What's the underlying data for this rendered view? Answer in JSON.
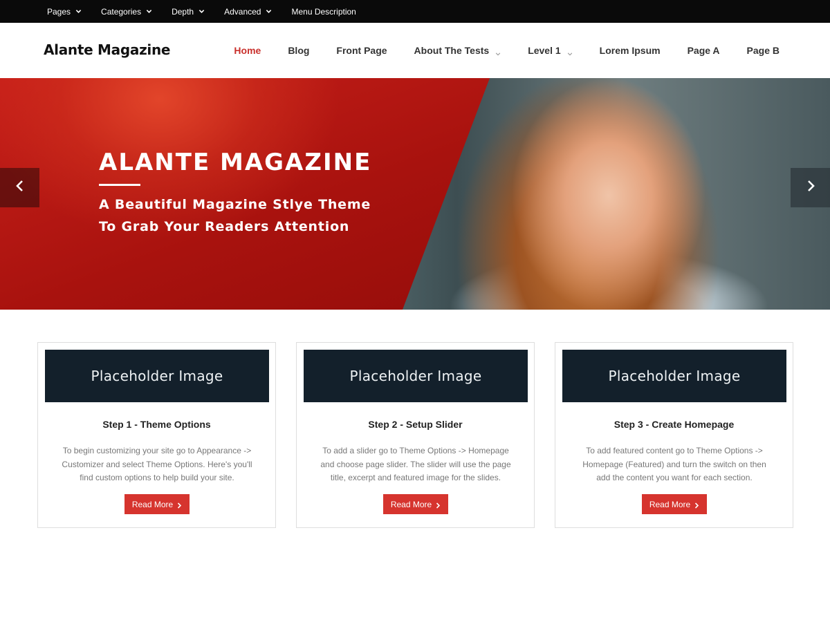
{
  "topbar": {
    "items": [
      {
        "label": "Pages",
        "has_dropdown": true
      },
      {
        "label": "Categories",
        "has_dropdown": true
      },
      {
        "label": "Depth",
        "has_dropdown": true
      },
      {
        "label": "Advanced",
        "has_dropdown": true
      },
      {
        "label": "Menu Description",
        "has_dropdown": false
      }
    ]
  },
  "header": {
    "site_title": "Alante Magazine",
    "nav": [
      {
        "label": "Home",
        "active": true,
        "has_dropdown": false
      },
      {
        "label": "Blog",
        "active": false,
        "has_dropdown": false
      },
      {
        "label": "Front Page",
        "active": false,
        "has_dropdown": false
      },
      {
        "label": "About The Tests",
        "active": false,
        "has_dropdown": true
      },
      {
        "label": "Level 1",
        "active": false,
        "has_dropdown": true
      },
      {
        "label": "Lorem Ipsum",
        "active": false,
        "has_dropdown": false
      },
      {
        "label": "Page A",
        "active": false,
        "has_dropdown": false
      },
      {
        "label": "Page B",
        "active": false,
        "has_dropdown": false
      }
    ]
  },
  "hero": {
    "title": "ALANTE MAGAZINE",
    "subtitle_line1": "A Beautiful Magazine Stlye Theme",
    "subtitle_line2": "To Grab Your Readers Attention",
    "prev_icon": "chevron-left-icon",
    "next_icon": "chevron-right-icon"
  },
  "cards": [
    {
      "image_text": "Placeholder Image",
      "title": "Step 1 - Theme Options",
      "text": "To begin customizing your site go to Appearance -> Customizer and select Theme Options. Here's you'll find custom options to help build your site.",
      "button": "Read More"
    },
    {
      "image_text": "Placeholder Image",
      "title": "Step 2 - Setup Slider",
      "text": "To add a slider go to Theme Options -> Homepage and choose page slider. The slider will use the page title, excerpt and featured image for the slides.",
      "button": "Read More"
    },
    {
      "image_text": "Placeholder Image",
      "title": "Step 3 - Create Homepage",
      "text": "To add featured content go to Theme Options -> Homepage (Featured) and turn the switch on then add the content you want for each section.",
      "button": "Read More"
    }
  ],
  "colors": {
    "accent": "#d6342e",
    "active_nav": "#c9302c",
    "topbar_bg": "#0a0a0a",
    "placeholder_bg": "#13202b"
  }
}
